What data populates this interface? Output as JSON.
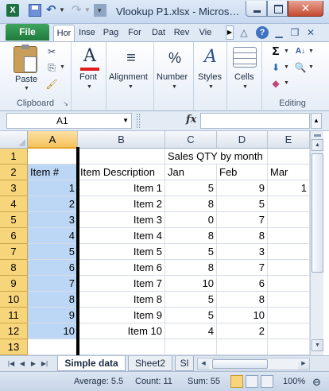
{
  "titlebar": {
    "logo": "X",
    "title": "Vlookup P1.xlsx - Micros…",
    "undo_glyph": "↶",
    "redo_glyph": "↷",
    "close_glyph": "✕"
  },
  "ribbon_tabs": {
    "file": "File",
    "tabs": [
      "Hor",
      "Inse",
      "Pag",
      "For",
      "Dat",
      "Rev",
      "Vie"
    ],
    "help": "?"
  },
  "ribbon": {
    "clipboard": {
      "paste": "Paste",
      "label": "Clipboard"
    },
    "font": {
      "label": "Font"
    },
    "alignment": {
      "label": "Alignment"
    },
    "number": {
      "label": "Number",
      "glyph": "%"
    },
    "styles": {
      "label": "Styles"
    },
    "cells": {
      "label": "Cells"
    },
    "editing": {
      "label": "Editing",
      "sum_glyph": "Σ"
    }
  },
  "formula_bar": {
    "name_box": "A1",
    "fx": "fx",
    "content": ""
  },
  "grid": {
    "columns": [
      "A",
      "B",
      "C",
      "D",
      "E"
    ],
    "rows": [
      {
        "n": "1",
        "A": "",
        "B": "",
        "C": "Sales QTY by month",
        "D": "",
        "E": ""
      },
      {
        "n": "2",
        "A": "Item #",
        "B": "Item Description",
        "C": "Jan",
        "D": "Feb",
        "E": "Mar"
      },
      {
        "n": "3",
        "A": "1",
        "B": "Item 1",
        "C": "5",
        "D": "9",
        "E": "1"
      },
      {
        "n": "4",
        "A": "2",
        "B": "Item 2",
        "C": "8",
        "D": "5",
        "E": ""
      },
      {
        "n": "5",
        "A": "3",
        "B": "Item 3",
        "C": "0",
        "D": "7",
        "E": ""
      },
      {
        "n": "6",
        "A": "4",
        "B": "Item 4",
        "C": "8",
        "D": "8",
        "E": ""
      },
      {
        "n": "7",
        "A": "5",
        "B": "Item 5",
        "C": "5",
        "D": "3",
        "E": ""
      },
      {
        "n": "8",
        "A": "6",
        "B": "Item 6",
        "C": "8",
        "D": "7",
        "E": ""
      },
      {
        "n": "9",
        "A": "7",
        "B": "Item 7",
        "C": "10",
        "D": "6",
        "E": ""
      },
      {
        "n": "10",
        "A": "8",
        "B": "Item 8",
        "C": "5",
        "D": "8",
        "E": ""
      },
      {
        "n": "11",
        "A": "9",
        "B": "Item 9",
        "C": "5",
        "D": "10",
        "E": ""
      },
      {
        "n": "12",
        "A": "10",
        "B": "Item 10",
        "C": "4",
        "D": "2",
        "E": ""
      },
      {
        "n": "13",
        "A": "",
        "B": "",
        "C": "",
        "D": "",
        "E": ""
      }
    ]
  },
  "sheets": {
    "tabs": [
      "Simple data",
      "Sheet2",
      "Sl"
    ],
    "active": "Simple data"
  },
  "status": {
    "average": "Average: 5.5",
    "count": "Count: 11",
    "sum": "Sum: 55",
    "zoom": "100%"
  },
  "colors": {
    "selection": "#bcd7f5",
    "row_header": "#f7d57a",
    "file_tab": "#1f7a3c",
    "close_button": "#c44a30"
  }
}
